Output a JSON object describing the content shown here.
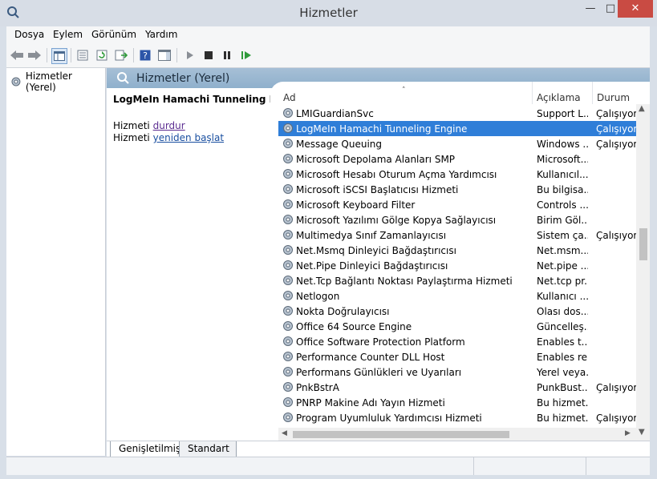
{
  "window": {
    "title": "Hizmetler"
  },
  "menu": [
    "Dosya",
    "Eylem",
    "Görünüm",
    "Yardım"
  ],
  "tree": {
    "root": "Hizmetler (Yerel)"
  },
  "panel": {
    "title": "Hizmetler (Yerel)"
  },
  "description": {
    "service_name": "LogMeIn Hamachi Tunneling Engine",
    "prefix": "Hizmeti",
    "stop_link": "durdur",
    "restart_link": "yeniden başlat"
  },
  "columns": {
    "name": "Ad",
    "desc": "Açıklama",
    "status": "Durum"
  },
  "services": [
    {
      "name": "LMIGuardianSvc",
      "desc": "Support L...",
      "status": "Çalışıyor"
    },
    {
      "name": "LogMeIn Hamachi Tunneling Engine",
      "desc": "",
      "status": "Çalışıyor",
      "selected": true
    },
    {
      "name": "Message Queuing",
      "desc": "Windows ...",
      "status": "Çalışıyor"
    },
    {
      "name": "Microsoft Depolama Alanları SMP",
      "desc": "Microsoft...",
      "status": ""
    },
    {
      "name": "Microsoft Hesabı Oturum Açma Yardımcısı",
      "desc": "Kullanıcıl...",
      "status": ""
    },
    {
      "name": "Microsoft iSCSI Başlatıcısı Hizmeti",
      "desc": "Bu bilgisa...",
      "status": ""
    },
    {
      "name": "Microsoft Keyboard Filter",
      "desc": "Controls ...",
      "status": ""
    },
    {
      "name": "Microsoft Yazılımı Gölge Kopya Sağlayıcısı",
      "desc": "Birim Göl...",
      "status": ""
    },
    {
      "name": "Multimedya Sınıf Zamanlayıcısı",
      "desc": "Sistem ça...",
      "status": "Çalışıyor"
    },
    {
      "name": "Net.Msmq Dinleyici Bağdaştırıcısı",
      "desc": "Net.msm...",
      "status": ""
    },
    {
      "name": "Net.Pipe Dinleyici Bağdaştırıcısı",
      "desc": "Net.pipe ...",
      "status": ""
    },
    {
      "name": "Net.Tcp Bağlantı Noktası Paylaştırma Hizmeti",
      "desc": "Net.tcp pr...",
      "status": ""
    },
    {
      "name": "Netlogon",
      "desc": "Kullanıcı ...",
      "status": ""
    },
    {
      "name": "Nokta Doğrulayıcısı",
      "desc": "Olası dos...",
      "status": ""
    },
    {
      "name": "Office 64 Source Engine",
      "desc": "Güncelleş...",
      "status": ""
    },
    {
      "name": "Office Software Protection Platform",
      "desc": "Enables t...",
      "status": ""
    },
    {
      "name": "Performance Counter DLL Host",
      "desc": "Enables re...",
      "status": ""
    },
    {
      "name": "Performans Günlükleri ve Uyarıları",
      "desc": "Yerel veya...",
      "status": ""
    },
    {
      "name": "PnkBstrA",
      "desc": "PunkBust...",
      "status": "Çalışıyor"
    },
    {
      "name": "PNRP Makine Adı Yayın Hizmeti",
      "desc": "Bu hizmet...",
      "status": ""
    },
    {
      "name": "Program Uyumluluk Yardımcısı Hizmeti",
      "desc": "Bu hizmet...",
      "status": "Çalışıyor"
    }
  ],
  "tabs": [
    "Genişletilmiş",
    "Standart"
  ]
}
